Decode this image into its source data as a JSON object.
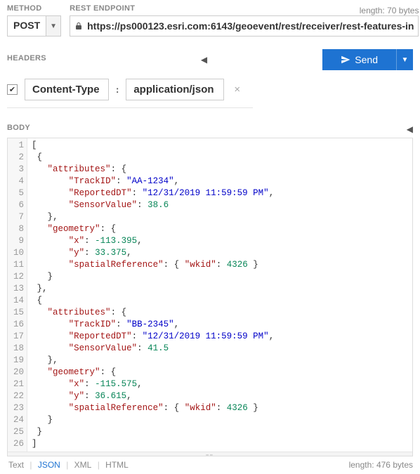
{
  "method": {
    "label": "METHOD",
    "value": "POST"
  },
  "endpoint": {
    "label": "REST ENDPOINT",
    "length_text": "length: 70 bytes",
    "url": "https://ps000123.esri.com:6143/geoevent/rest/receiver/rest-features-in"
  },
  "headers": {
    "label": "HEADERS",
    "checked": "✔",
    "key": "Content-Type",
    "colon": ":",
    "value": "application/json"
  },
  "send": {
    "label": "Send"
  },
  "body": {
    "label": "BODY",
    "length_text": "length: 476 bytes"
  },
  "footer": {
    "tabs": {
      "text": "Text",
      "json": "JSON",
      "xml": "XML",
      "html": "HTML"
    }
  },
  "code_lines": [
    "[",
    " {",
    "   \"attributes\": {",
    "       \"TrackID\": \"AA-1234\",",
    "       \"ReportedDT\": \"12/31/2019 11:59:59 PM\",",
    "       \"SensorValue\": 38.6",
    "   },",
    "   \"geometry\": {",
    "       \"x\": -113.395,",
    "       \"y\": 33.375,",
    "       \"spatialReference\": { \"wkid\": 4326 }",
    "   }",
    " },",
    " {",
    "   \"attributes\": {",
    "       \"TrackID\": \"BB-2345\",",
    "       \"ReportedDT\": \"12/31/2019 11:59:59 PM\",",
    "       \"SensorValue\": 41.5",
    "   },",
    "   \"geometry\": {",
    "       \"x\": -115.575,",
    "       \"y\": 36.615,",
    "       \"spatialReference\": { \"wkid\": 4326 }",
    "   }",
    " }",
    "]"
  ]
}
